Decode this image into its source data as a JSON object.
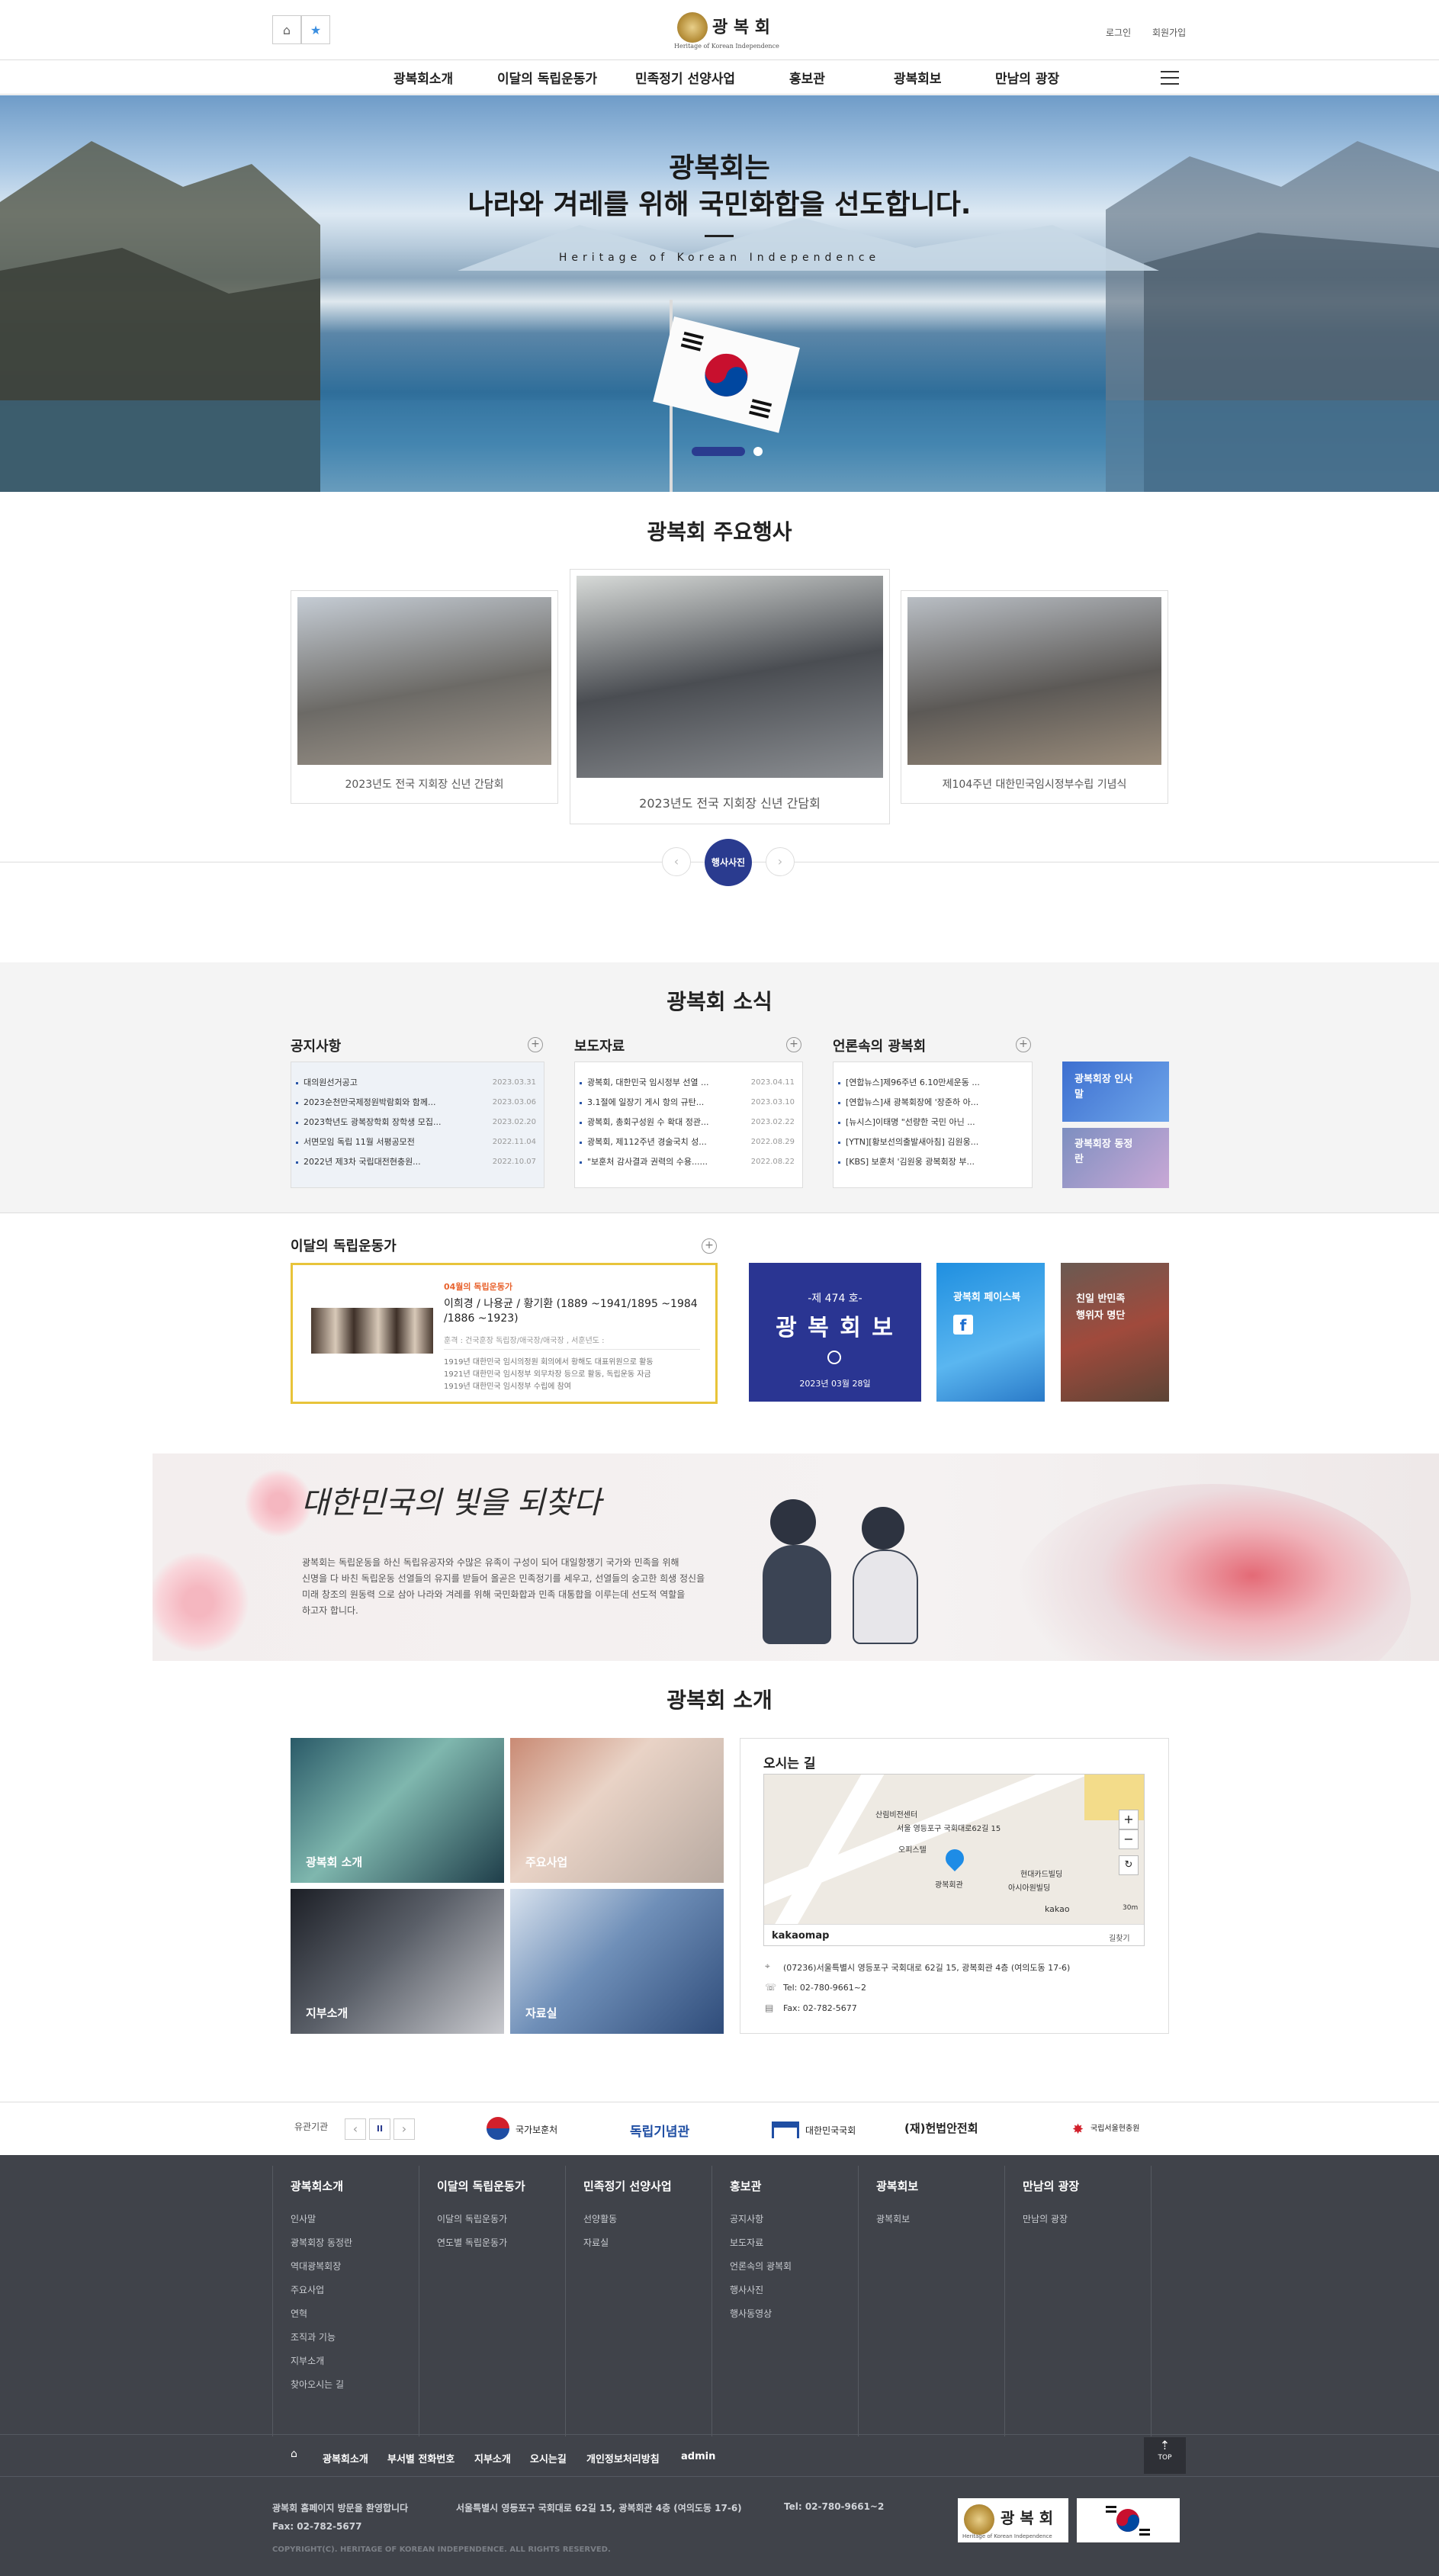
{
  "header": {
    "logo_title": "광 복 회",
    "logo_subtitle": "Heritage of Korean Independence",
    "login": "로그인",
    "signup": "회원가입"
  },
  "nav": {
    "items": [
      "광복회소개",
      "이달의 독립운동가",
      "민족정기 선양사업",
      "홍보관",
      "광복회보",
      "만남의 광장"
    ]
  },
  "hero": {
    "line1": "광복회는",
    "line2": "나라와 겨레를 위해 국민화합을 선도합니다.",
    "tagline": "Heritage of Korean Independence"
  },
  "events": {
    "title": "광복회 주요행사",
    "cards": [
      {
        "caption": "2023년도 전국 지회장 신년 간담회"
      },
      {
        "caption": "2023년도 전국 지회장 신년 간담회"
      },
      {
        "caption": "제104주년 대한민국임시정부수립 기념식"
      }
    ],
    "center_button": "행사사진"
  },
  "news": {
    "title": "광복회 소식",
    "notice": {
      "heading": "공지사항",
      "items": [
        {
          "text": "대의원선거공고",
          "date": "2023.03.31"
        },
        {
          "text": "2023순천만국제정원박람회와 함께...",
          "date": "2023.03.06"
        },
        {
          "text": "2023학년도 광복장학회 장학생 모집...",
          "date": "2023.02.20"
        },
        {
          "text": "서면모임 독립 11월 서평공모전",
          "date": "2022.11.04"
        },
        {
          "text": "2022년 제3차 국립대전현충원...",
          "date": "2022.10.07"
        }
      ]
    },
    "press": {
      "heading": "보도자료",
      "items": [
        {
          "text": "광복회, 대한민국 임시정부 선열 ...",
          "date": "2023.04.11"
        },
        {
          "text": "3.1절에 일장기 게시 항의 규탄...",
          "date": "2023.03.10"
        },
        {
          "text": "광복회, 총회구성원 수 확대 정관...",
          "date": "2023.02.22"
        },
        {
          "text": "광복회, 제112주년 경술국치 성...",
          "date": "2022.08.29"
        },
        {
          "text": "\"보훈처 감사결과 권력의 수용......",
          "date": "2022.08.22"
        }
      ]
    },
    "media": {
      "heading": "언론속의 광복회",
      "items": [
        {
          "text": "[연합뉴스]제96주년 6.10만세운동 ..."
        },
        {
          "text": "[연합뉴스]새 광복회장에 '장준하 아..."
        },
        {
          "text": "[뉴시스]이태명 \"선량한 국민 아닌 ..."
        },
        {
          "text": "[YTN][황보선의출발새아침] 김원웅..."
        },
        {
          "text": "[KBS] 보훈처 '김원웅 광복회장 부..."
        }
      ]
    },
    "side_banners": [
      "광복회장 인사말",
      "광복회장 동정란"
    ]
  },
  "monthly": {
    "heading": "이달의 독립운동가",
    "tag": "04월의 독립운동가",
    "names": "이희경 / 나용균 / 황기환  (1889 ~1941/1895 ~1984 /1886 ~1923)",
    "honor": "훈격 : 건국훈장 독립장/애국장/애국장 , 서훈년도 :",
    "desc1": "1919년 대한민국 임시의정원 회의에서 황해도 대표위원으로 활동",
    "desc2": "1921년 대한민국 임시정부 외무차장 등으로 활동, 독립운동 자금",
    "desc3": "1919년 대한민국 임시정부 수립에 참여"
  },
  "promo": {
    "newspaper_issue": "-제 474 호-",
    "newspaper_title": "광 복 회 보",
    "newspaper_date": "2023년 03월 28일",
    "facebook": "광복회 페이스북",
    "anti_label1": "친일 반민족",
    "anti_label2": "행위자 명단"
  },
  "banner": {
    "calligraphy": "대한민국의 빛을 되찾다",
    "text1": "광복회는 독립운동을 하신 독립유공자와 수많은 유족이 구성이 되어 대일항쟁기 국가와 민족을 위해",
    "text2": "신명을 다 바친 독립운동 선열들의 유지를 받들어 올곧은 민족정기를 세우고, 선열들의 숭고한 희생 정신을",
    "text3": "미래 창조의 원동력 으로 삼아 나라와 겨레를 위해 국민화합과 민족 대통합을 이루는데 선도적 역할을",
    "text4": "하고자 합니다."
  },
  "intro": {
    "title": "광복회 소개",
    "tiles": [
      "광복회 소개",
      "주요사업",
      "지부소개",
      "자료실"
    ],
    "map_heading": "오시는 길",
    "map_labels": [
      "산림비전센터",
      "서울 영등포구 국회대로62길 15",
      "오피스텔",
      "광복회관",
      "현대카드빌딩",
      "아시아원빌딩",
      "kakao",
      "30m",
      "kakaomap",
      "길찾기"
    ],
    "address": "(07236)서울특별시 영등포구 국회대로 62길 15, 광복회관 4층 (여의도동 17-6)",
    "tel": "Tel: 02-780-9661~2",
    "fax": "Fax: 02-782-5677"
  },
  "related": {
    "label": "유관기관",
    "orgs": [
      "국가보훈처",
      "독립기념관",
      "대한민국국회",
      "(재)헌법안전회",
      "국립서울현충원"
    ]
  },
  "footer": {
    "columns": [
      {
        "heading": "광복회소개",
        "links": [
          "인사말",
          "광복회장 동정란",
          "역대광복회장",
          "주요사업",
          "연혁",
          "조직과 기능",
          "지부소개",
          "찾아오시는 길"
        ]
      },
      {
        "heading": "이달의 독립운동가",
        "links": [
          "이달의 독립운동가",
          "연도별 독립운동가"
        ]
      },
      {
        "heading": "민족정기 선양사업",
        "links": [
          "선양활동",
          "자료실"
        ]
      },
      {
        "heading": "홍보관",
        "links": [
          "공지사항",
          "보도자료",
          "언론속의 광복회",
          "행사사진",
          "행사동영상"
        ]
      },
      {
        "heading": "광복회보",
        "links": [
          "광복회보"
        ]
      },
      {
        "heading": "만남의 광장",
        "links": [
          "만남의 광장"
        ]
      }
    ],
    "bottom_links": [
      "광복회소개",
      "부서별 전화번호",
      "지부소개",
      "오시는길",
      "개인정보처리방침",
      "admin"
    ],
    "top_button": "TOP",
    "welcome": "광복회 홈페이지 방문을 환영합니다",
    "address": "서울특별시 영등포구 국회대로 62길 15, 광복회관 4층 (여의도동 17-6)",
    "tel": "Tel: 02-780-9661~2",
    "fax": "Fax: 02-782-5677",
    "copyright": "COPYRIGHT(C). HERITAGE OF KOREAN INDEPENDENCE. ALL RIGHTS RESERVED."
  },
  "colors": {
    "navy": "#2a3b8f",
    "gold": "#e4c43a",
    "footer": "#40434a"
  }
}
